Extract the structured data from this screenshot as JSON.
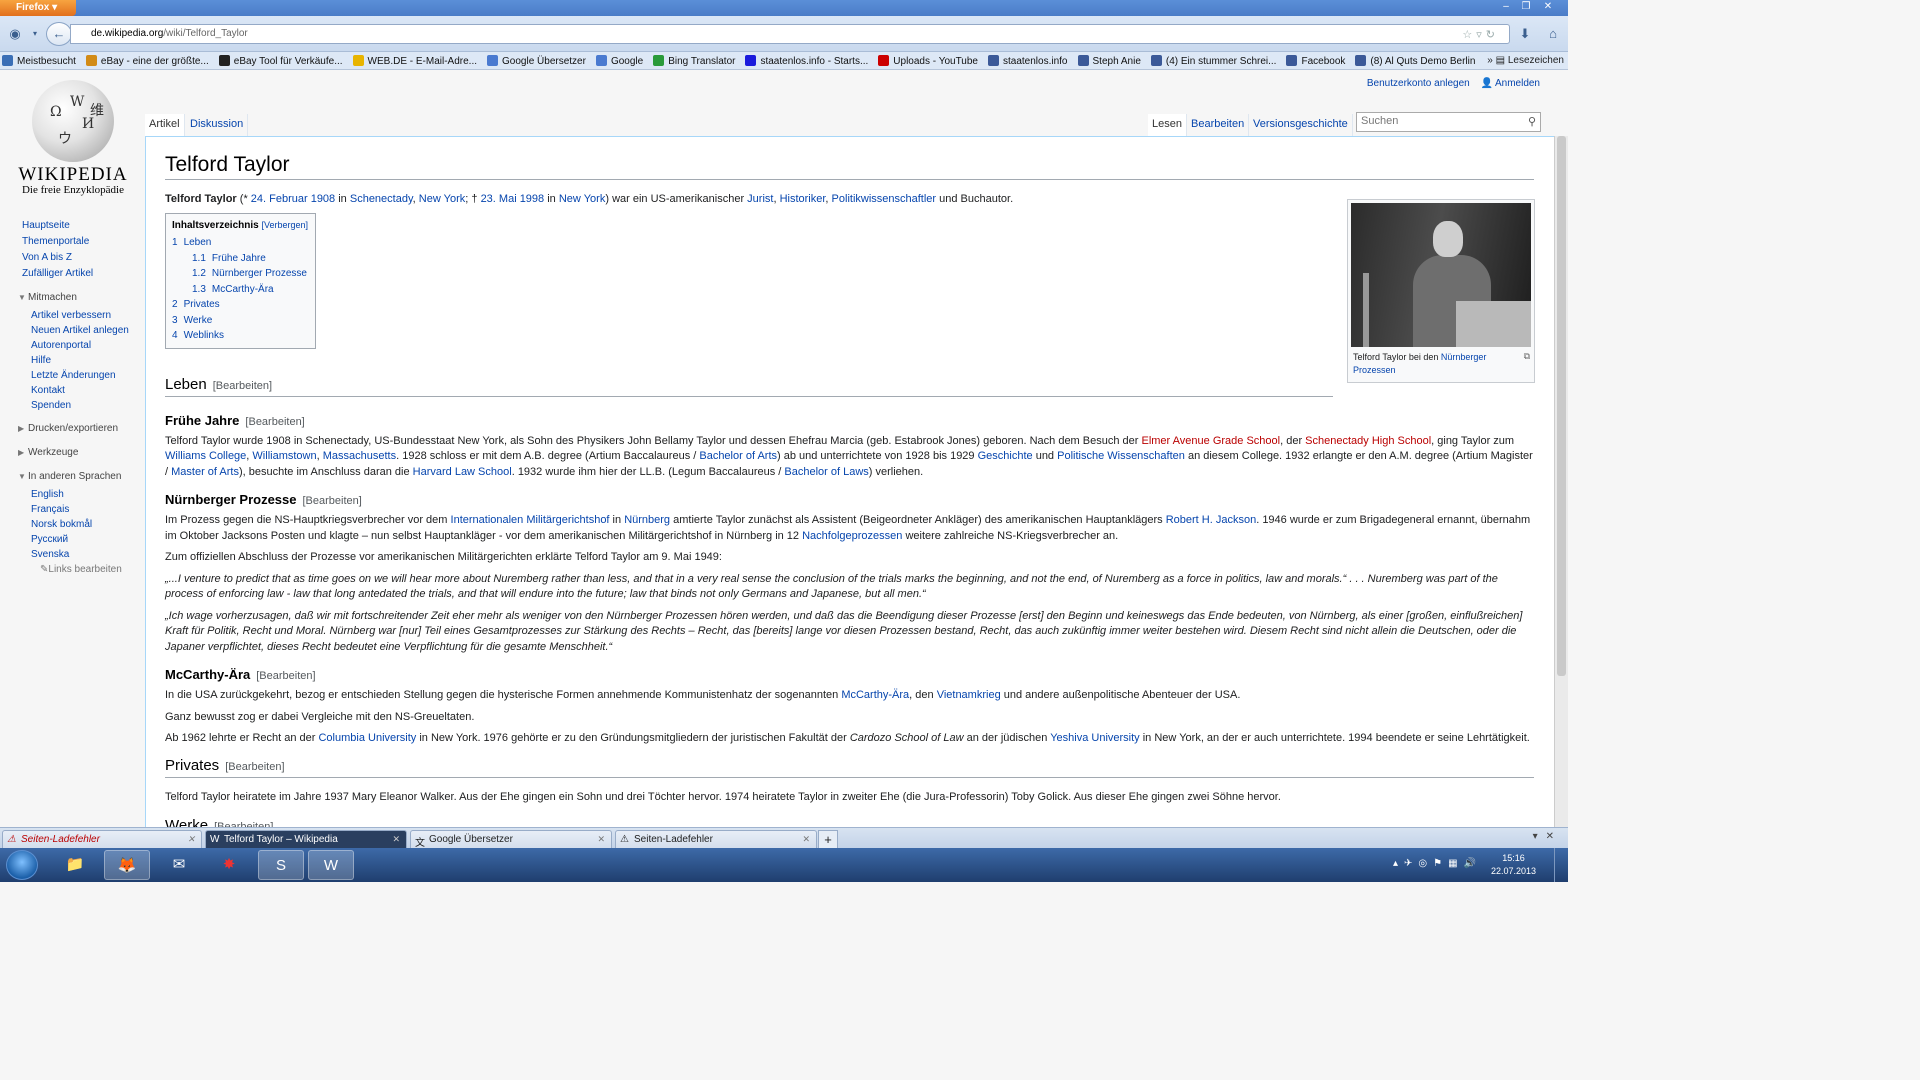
{
  "browser": {
    "menu_label": "Firefox",
    "url_domain": "de.wikipedia.org",
    "url_path": "/wiki/Telford_Taylor",
    "bookmarks_more": "Lesezeichen",
    "bookmarks": [
      {
        "label": "Meistbesucht",
        "icon": "star-icon",
        "color": "#3b6fb6"
      },
      {
        "label": "eBay - eine der größte...",
        "icon": "shopping-bag-icon",
        "color": "#d28b16"
      },
      {
        "label": "eBay Tool für Verkäufe...",
        "icon": "t-icon",
        "color": "#222222"
      },
      {
        "label": "WEB.DE - E-Mail-Adre...",
        "icon": "webde-icon",
        "color": "#e8b400"
      },
      {
        "label": "Google Übersetzer",
        "icon": "translate-icon",
        "color": "#4a7ad0"
      },
      {
        "label": "Google",
        "icon": "google-icon",
        "color": "#4a7ad0"
      },
      {
        "label": "Bing Translator",
        "icon": "people-icon",
        "color": "#2a9b3a"
      },
      {
        "label": "staatenlos.info - Starts...",
        "icon": "circle-icon",
        "color": "#1a1adc"
      },
      {
        "label": "Uploads - YouTube",
        "icon": "youtube-icon",
        "color": "#cc0000"
      },
      {
        "label": "staatenlos.info",
        "icon": "facebook-icon",
        "color": "#3b5998"
      },
      {
        "label": "Steph Anie",
        "icon": "facebook-icon",
        "color": "#3b5998"
      },
      {
        "label": "(4) Ein stummer Schrei...",
        "icon": "facebook-icon",
        "color": "#3b5998"
      },
      {
        "label": "Facebook",
        "icon": "facebook-icon",
        "color": "#3b5998"
      },
      {
        "label": "(8) Al Quts Demo Berlin",
        "icon": "facebook-icon",
        "color": "#3b5998"
      }
    ],
    "tabs": [
      {
        "label": "Seiten-Ladefehler",
        "icon": "warning-icon"
      },
      {
        "label": "Telford Taylor – Wikipedia",
        "icon": "wikipedia-icon"
      },
      {
        "label": "Google Übersetzer",
        "icon": "translate-icon"
      },
      {
        "label": "Seiten-Ladefehler",
        "icon": "warning-icon"
      }
    ]
  },
  "wiki": {
    "logo_word": "WIKIPEDIA",
    "logo_tagline": "Die freie Enzyklopädie",
    "personal": {
      "create_account": "Benutzerkonto anlegen",
      "login": "Anmelden"
    },
    "tabs_left": [
      "Artikel",
      "Diskussion"
    ],
    "tabs_right": [
      "Lesen",
      "Bearbeiten",
      "Versionsgeschichte"
    ],
    "search_placeholder": "Suchen",
    "nav_main": [
      "Hauptseite",
      "Themenportale",
      "Von A bis Z",
      "Zufälliger Artikel"
    ],
    "mitmachen": {
      "heading": "Mitmachen",
      "items": [
        "Artikel verbessern",
        "Neuen Artikel anlegen",
        "Autorenportal",
        "Hilfe",
        "Letzte Änderungen",
        "Kontakt",
        "Spenden"
      ]
    },
    "drucken": "Drucken/exportieren",
    "werkzeuge": "Werkzeuge",
    "languages": {
      "heading": "In anderen Sprachen",
      "items": [
        "English",
        "Français",
        "Norsk bokmål",
        "Русский",
        "Svenska"
      ],
      "edit_links": "Links bearbeiten"
    }
  },
  "article": {
    "title": "Telford Taylor",
    "edit_label": "[Bearbeiten]",
    "intro": {
      "name": "Telford Taylor",
      "t1": " (* ",
      "birth_date": "24. Februar 1908",
      "t2": " in ",
      "birth_city": "Schenectady",
      "t3": ", ",
      "birth_state": "New York",
      "t4": "; † ",
      "death_date": "23. Mai 1998",
      "t5": " in ",
      "death_place": "New York",
      "t6": ") war ein US-amerikanischer ",
      "jurist": "Jurist",
      "t7": ", ",
      "historiker": "Historiker",
      "t8": ", ",
      "polit": "Politikwissenschaftler",
      "t9": " und Buchautor."
    },
    "infobox": {
      "caption_text": "Telford Taylor bei den ",
      "caption_link": "Nürnberger Prozessen"
    },
    "toc": {
      "title": "Inhaltsverzeichnis",
      "hide": "[Verbergen]",
      "items": [
        {
          "num": "1",
          "label": "Leben"
        },
        {
          "num": "1.1",
          "label": "Frühe Jahre"
        },
        {
          "num": "1.2",
          "label": "Nürnberger Prozesse"
        },
        {
          "num": "1.3",
          "label": "McCarthy-Ära"
        },
        {
          "num": "2",
          "label": "Privates"
        },
        {
          "num": "3",
          "label": "Werke"
        },
        {
          "num": "4",
          "label": "Weblinks"
        }
      ]
    },
    "leben": {
      "heading": "Leben"
    },
    "fruehe": {
      "heading": "Frühe Jahre",
      "s1": "Telford Taylor wurde 1908 in Schenectady, US-Bundesstaat New York, als Sohn des Physikers John Bellamy Taylor und dessen Ehefrau Marcia (geb. Estabrook Jones) geboren. Nach dem Besuch der ",
      "l1": "Elmer Avenue Grade School",
      "s2": ", der ",
      "l2": "Schenectady High School",
      "s3": ", ging Taylor zum ",
      "l3": "Williams College",
      "s4": ", ",
      "l4": "Williamstown",
      "s5": ", ",
      "l5": "Massachusetts",
      "s6": ". 1928 schloss er mit dem A.B. degree (Artium Baccalaureus / ",
      "l6": "Bachelor of Arts",
      "s7": ") ab und unterrichtete von 1928 bis 1929 ",
      "l7": "Geschichte",
      "s8": " und ",
      "l8": "Politische Wissenschaften",
      "s9": " an diesem College. 1932 erlangte er den A.M. degree (Artium Magister / ",
      "l9": "Master of Arts",
      "s10": "), besuchte im Anschluss daran die ",
      "l10": "Harvard Law School",
      "s11": ". 1932 wurde ihm hier der LL.B. (Legum Baccalaureus / ",
      "l11": "Bachelor of Laws",
      "s12": ") verliehen."
    },
    "nuernberg": {
      "heading": "Nürnberger Prozesse",
      "s1": "Im Prozess gegen die NS-Hauptkriegsverbrecher vor dem ",
      "l1": "Internationalen Militärgerichtshof",
      "s2": " in ",
      "l2": "Nürnberg",
      "s3": " amtierte Taylor zunächst als Assistent (Beigeordneter Ankläger) des amerikanischen Hauptanklägers ",
      "l3": "Robert H. Jackson",
      "s4": ". 1946 wurde er zum Brigadegeneral ernannt, übernahm im Oktober Jacksons Posten und klagte – nun selbst Hauptankläger - vor dem amerikanischen Militärgerichtshof in Nürnberg in 12 ",
      "l4": "Nachfolgeprozessen",
      "s5": " weitere zahlreiche NS-Kriegsverbrecher an.",
      "p2": "Zum offiziellen Abschluss der Prozesse vor amerikanischen Militärgerichten erklärte Telford Taylor am 9. Mai 1949:",
      "quote_en": "„...I venture to predict that as time goes on we will hear more about Nuremberg rather than less, and that in a very real sense the conclusion of the trials marks the beginning, and not the end, of Nuremberg as a force in politics, law and morals.“ . . . Nuremberg was part of the process of enforcing law - law that long antedated the trials, and that will endure into the future; law that binds not only Germans and Japanese, but all men.“",
      "quote_de": "„Ich wage vorherzusagen, daß wir mit fortschreitender Zeit eher mehr als weniger von den Nürnberger Prozessen hören werden, und daß das die Beendigung dieser Prozesse [erst] den Beginn und keineswegs das Ende bedeuten, von Nürnberg, als einer [großen, einflußreichen] Kraft für Politik, Recht und Moral. Nürnberg war [nur] Teil eines Gesamtprozesses zur Stärkung des Rechts – Recht, das [bereits] lange vor diesen Prozessen bestand, Recht, das auch zukünftig immer weiter bestehen wird. Diesem Recht sind nicht allein die Deutschen, oder die Japaner verpflichtet, dieses Recht bedeutet eine Verpflichtung für die gesamte Menschheit.“"
    },
    "mccarthy": {
      "heading": "McCarthy-Ära",
      "s1": "In die USA zurückgekehrt, bezog er entschieden Stellung gegen die hysterische Formen annehmende Kommunistenhatz der sogenannten ",
      "l1": "McCarthy-Ära",
      "s2": ", den ",
      "l2": "Vietnamkrieg",
      "s3": " und andere außenpolitische Abenteuer der USA.",
      "p2": "Ganz bewusst zog er dabei Vergleiche mit den NS-Greueltaten.",
      "p3a": "Ab 1962 lehrte er Recht an der ",
      "p3l1": "Columbia University",
      "p3b": " in New York. 1976 gehörte er zu den Gründungsmitgliedern der juristischen Fakultät der ",
      "p3i": "Cardozo School of Law",
      "p3c": " an der jüdischen ",
      "p3l2": "Yeshiva University",
      "p3d": " in New York, an der er auch unterrichtete. 1994 beendete er seine Lehrtätigkeit."
    },
    "privates": {
      "heading": "Privates",
      "p": "Telford Taylor heiratete im Jahre 1937 Mary Eleanor Walker. Aus der Ehe gingen ein Sohn und drei Töchter hervor. 1974 heiratete Taylor in zweiter Ehe (die Jura-Professorin) Toby Golick. Aus dieser Ehe gingen zwei Söhne hervor."
    },
    "werke": {
      "heading": "Werke"
    }
  },
  "taskbar": {
    "time": "15:16",
    "date": "22.07.2013"
  }
}
